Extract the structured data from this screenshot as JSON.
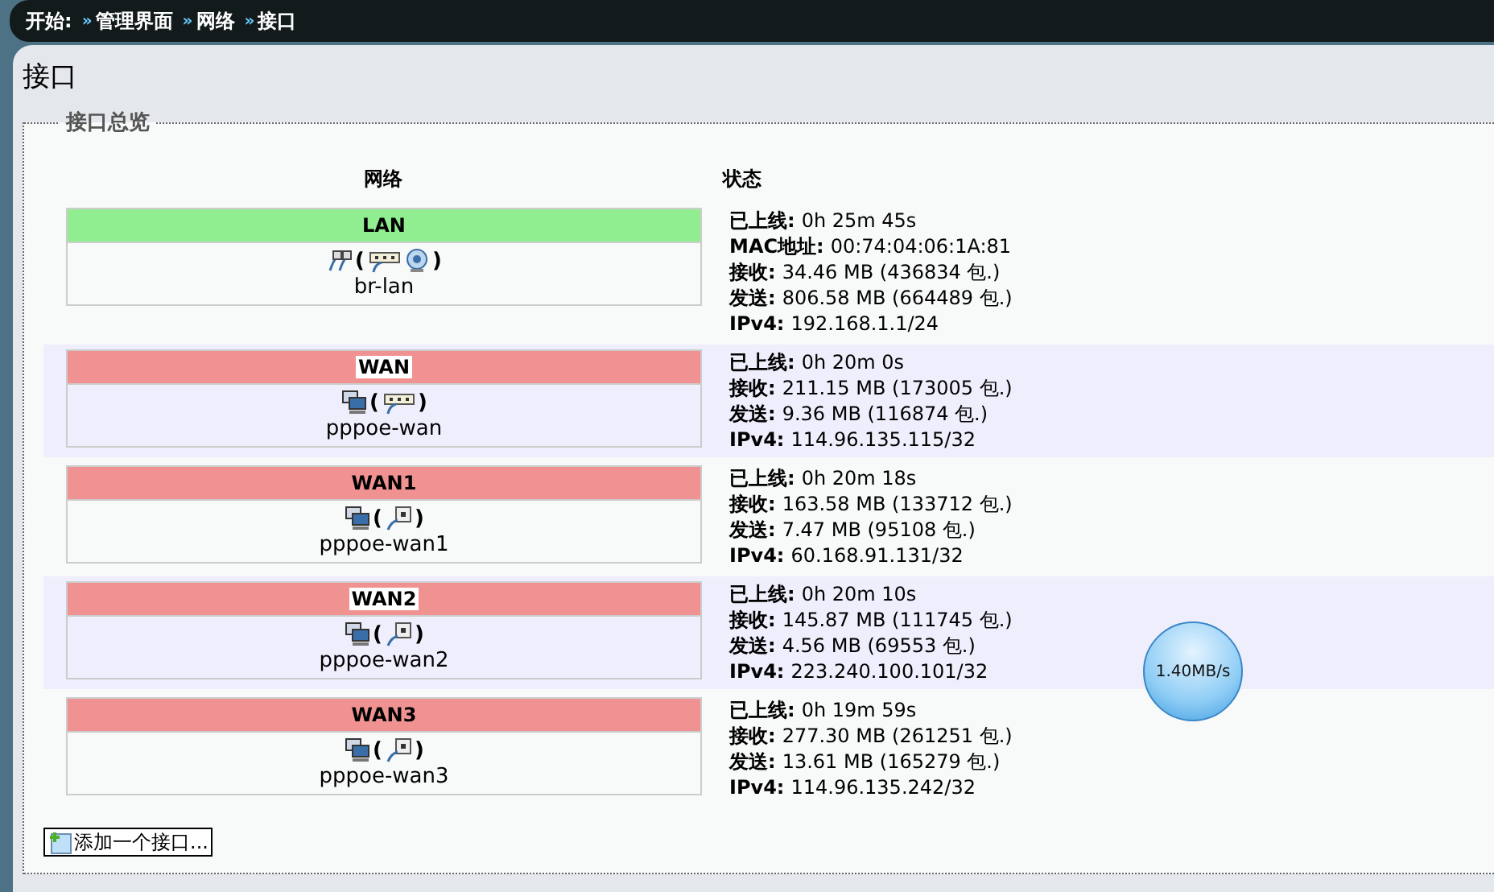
{
  "breadcrumb": [
    {
      "label": "开始:"
    },
    {
      "separator": "»",
      "label": "管理界面"
    },
    {
      "separator": "»",
      "label": "网络"
    },
    {
      "separator": "»",
      "label": "接口"
    }
  ],
  "member_brackets": [
    "(",
    ")"
  ],
  "page_title": "接口",
  "section_title": "接口总览",
  "columns": [
    "网络",
    "状态"
  ],
  "interfaces": [
    {
      "name": "LAN",
      "color": "#90ee90",
      "highlighted": false,
      "kind": "bridge",
      "device": "br-lan",
      "status": [
        {
          "label": "已上线:",
          "value": "0h 25m 45s"
        },
        {
          "label": "MAC地址:",
          "value": "00:74:04:06:1A:81"
        },
        {
          "label": "接收:",
          "value": "34.46 MB (436834 包.)"
        },
        {
          "label": "发送:",
          "value": "806.58 MB (664489 包.)"
        },
        {
          "label": "IPv4:",
          "value": "192.168.1.1/24"
        }
      ]
    },
    {
      "name": "WAN",
      "color": "#f19292",
      "highlighted": true,
      "kind": "ethernet",
      "device": "pppoe-wan",
      "status": [
        {
          "label": "已上线:",
          "value": "0h 20m 0s"
        },
        {
          "label": "接收:",
          "value": "211.15 MB (173005 包.)"
        },
        {
          "label": "发送:",
          "value": "9.36 MB (116874 包.)"
        },
        {
          "label": "IPv4:",
          "value": "114.96.135.115/32"
        }
      ]
    },
    {
      "name": "WAN1",
      "color": "#f19292",
      "highlighted": false,
      "kind": "pppoe",
      "device": "pppoe-wan1",
      "status": [
        {
          "label": "已上线:",
          "value": "0h 20m 18s"
        },
        {
          "label": "接收:",
          "value": "163.58 MB (133712 包.)"
        },
        {
          "label": "发送:",
          "value": "7.47 MB (95108 包.)"
        },
        {
          "label": "IPv4:",
          "value": "60.168.91.131/32"
        }
      ]
    },
    {
      "name": "WAN2",
      "color": "#f19292",
      "highlighted": true,
      "kind": "pppoe",
      "device": "pppoe-wan2",
      "status": [
        {
          "label": "已上线:",
          "value": "0h 20m 10s"
        },
        {
          "label": "接收:",
          "value": "145.87 MB (111745 包.)"
        },
        {
          "label": "发送:",
          "value": "4.56 MB (69553 包.)"
        },
        {
          "label": "IPv4:",
          "value": "223.240.100.101/32"
        }
      ]
    },
    {
      "name": "WAN3",
      "color": "#f19292",
      "highlighted": false,
      "kind": "pppoe",
      "device": "pppoe-wan3",
      "status": [
        {
          "label": "已上线:",
          "value": "0h 19m 59s"
        },
        {
          "label": "接收:",
          "value": "277.30 MB (261251 包.)"
        },
        {
          "label": "发送:",
          "value": "13.61 MB (165279 包.)"
        },
        {
          "label": "IPv4:",
          "value": "114.96.135.242/32"
        }
      ]
    }
  ],
  "add_button": "添加一个接口...",
  "speed_widget": "1.40MB/s"
}
